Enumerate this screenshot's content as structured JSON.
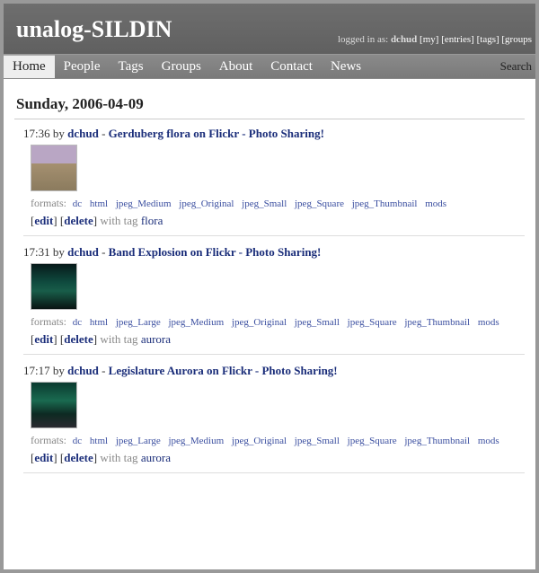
{
  "site_title": "unalog-SILDIN",
  "login": {
    "prefix": "logged in as: ",
    "user": "dchud",
    "links": [
      "[my]",
      "[entries]",
      "[tags]",
      "[groups"
    ]
  },
  "nav": {
    "items": [
      "Home",
      "People",
      "Tags",
      "Groups",
      "About",
      "Contact",
      "News"
    ],
    "active_index": 0,
    "search_label": "Search"
  },
  "date_heading": "Sunday, 2006-04-09",
  "entries": [
    {
      "time": "17:36",
      "by_label": "by",
      "user": "dchud",
      "sep": "-",
      "title": "Gerduberg flora on Flickr - Photo Sharing!",
      "thumb_class": "th1",
      "formats_label": "formats:",
      "formats": [
        "dc",
        "html",
        "jpeg_Medium",
        "jpeg_Original",
        "jpeg_Small",
        "jpeg_Square",
        "jpeg_Thumbnail",
        "mods"
      ],
      "edit": "edit",
      "delete": "delete",
      "tag_prefix": "with tag",
      "tag": "flora"
    },
    {
      "time": "17:31",
      "by_label": "by",
      "user": "dchud",
      "sep": "-",
      "title": "Band Explosion on Flickr - Photo Sharing!",
      "thumb_class": "th2",
      "formats_label": "formats:",
      "formats": [
        "dc",
        "html",
        "jpeg_Large",
        "jpeg_Medium",
        "jpeg_Original",
        "jpeg_Small",
        "jpeg_Square",
        "jpeg_Thumbnail",
        "mods"
      ],
      "edit": "edit",
      "delete": "delete",
      "tag_prefix": "with tag",
      "tag": "aurora"
    },
    {
      "time": "17:17",
      "by_label": "by",
      "user": "dchud",
      "sep": "-",
      "title": "Legislature Aurora on Flickr - Photo Sharing!",
      "thumb_class": "th3",
      "formats_label": "formats:",
      "formats": [
        "dc",
        "html",
        "jpeg_Large",
        "jpeg_Medium",
        "jpeg_Original",
        "jpeg_Small",
        "jpeg_Square",
        "jpeg_Thumbnail",
        "mods"
      ],
      "edit": "edit",
      "delete": "delete",
      "tag_prefix": "with tag",
      "tag": "aurora"
    }
  ]
}
